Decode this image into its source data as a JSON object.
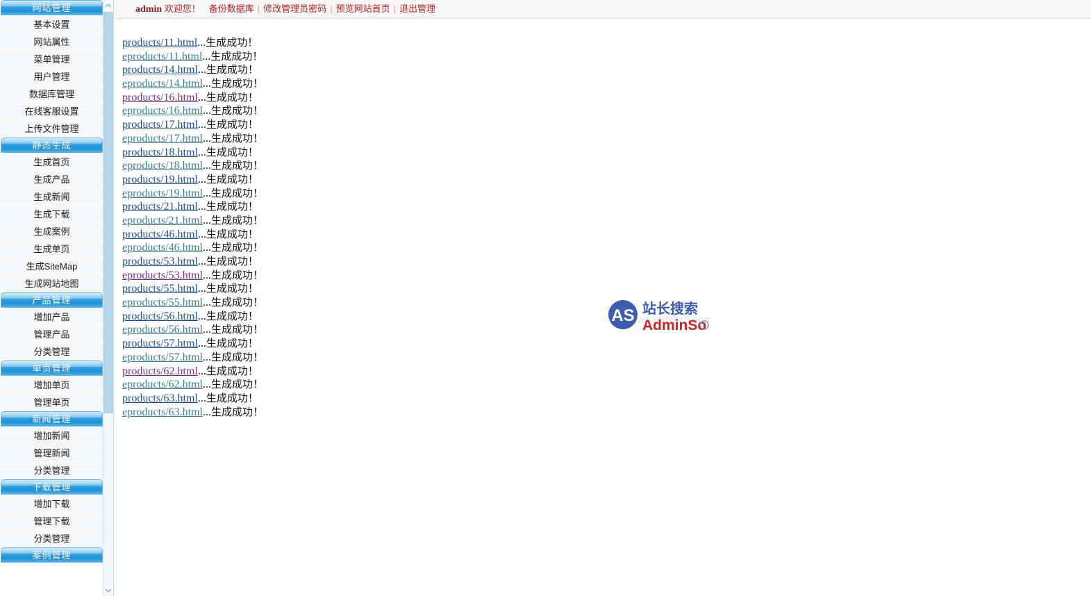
{
  "topbar": {
    "user": "admin",
    "welcome": "欢迎您！",
    "links": [
      {
        "label": "备份数据库"
      },
      {
        "label": "修改管理员密码"
      },
      {
        "label": "预览网站首页"
      },
      {
        "label": "退出管理"
      }
    ],
    "separator": "|"
  },
  "sidebar": {
    "scroll": {
      "up_icon": "chevron-up-icon",
      "down_icon": "chevron-down-icon"
    },
    "groups": [
      {
        "title": "网站管理",
        "items": [
          "基本设置",
          "网站属性",
          "菜单管理",
          "用户管理",
          "数据库管理",
          "在线客服设置",
          "上传文件管理"
        ]
      },
      {
        "title": "静态生成",
        "items": [
          "生成首页",
          "生成产品",
          "生成新闻",
          "生成下载",
          "生成案例",
          "生成单页",
          "生成SiteMap",
          "生成网站地图"
        ]
      },
      {
        "title": "产品管理",
        "items": [
          "增加产品",
          "管理产品",
          "分类管理"
        ]
      },
      {
        "title": "单页管理",
        "items": [
          "增加单页",
          "管理单页"
        ]
      },
      {
        "title": "新闻管理",
        "items": [
          "增加新闻",
          "管理新闻",
          "分类管理"
        ]
      },
      {
        "title": "下载管理",
        "items": [
          "增加下载",
          "管理下载",
          "分类管理"
        ]
      },
      {
        "title": "案例管理",
        "items": []
      }
    ]
  },
  "main": {
    "status_suffix": "生成成功！",
    "dots": "...",
    "rows": [
      {
        "file": "products/11.html",
        "state": "blue",
        "status": "生成成功！"
      },
      {
        "file": "eproducts/11.html",
        "state": "teal",
        "status": "生成成功！"
      },
      {
        "file": "products/14.html",
        "state": "blue",
        "status": "生成成功！"
      },
      {
        "file": "eproducts/14.html",
        "state": "teal",
        "status": "生成成功！"
      },
      {
        "file": "products/16.html",
        "state": "purple",
        "status": "生成成功！"
      },
      {
        "file": "eproducts/16.html",
        "state": "teal",
        "status": "生成成功！"
      },
      {
        "file": "products/17.html",
        "state": "blue",
        "status": "生成成功！"
      },
      {
        "file": "eproducts/17.html",
        "state": "teal",
        "status": "生成成功！"
      },
      {
        "file": "products/18.html",
        "state": "blue",
        "status": "生成成功！"
      },
      {
        "file": "eproducts/18.html",
        "state": "teal",
        "status": "生成成功！"
      },
      {
        "file": "products/19.html",
        "state": "blue",
        "status": "生成成功！"
      },
      {
        "file": "eproducts/19.html",
        "state": "teal",
        "status": "生成成功！"
      },
      {
        "file": "products/21.html",
        "state": "blue",
        "status": "生成成功！"
      },
      {
        "file": "eproducts/21.html",
        "state": "teal",
        "status": "生成成功！"
      },
      {
        "file": "products/46.html",
        "state": "blue",
        "status": "生成成功！"
      },
      {
        "file": "eproducts/46.html",
        "state": "teal",
        "status": "生成成功！"
      },
      {
        "file": "products/53.html",
        "state": "blue",
        "status": "生成成功！"
      },
      {
        "file": "eproducts/53.html",
        "state": "purple",
        "status": "生成成功！"
      },
      {
        "file": "products/55.html",
        "state": "blue",
        "status": "生成成功！"
      },
      {
        "file": "eproducts/55.html",
        "state": "teal",
        "status": "生成成功！"
      },
      {
        "file": "products/56.html",
        "state": "blue",
        "status": "生成成功！"
      },
      {
        "file": "eproducts/56.html",
        "state": "teal",
        "status": "生成成功！"
      },
      {
        "file": "products/57.html",
        "state": "blue",
        "status": "生成成功！"
      },
      {
        "file": "eproducts/57.html",
        "state": "teal",
        "status": "生成成功！"
      },
      {
        "file": "products/62.html",
        "state": "purple",
        "status": "生成成功！"
      },
      {
        "file": "eproducts/62.html",
        "state": "teal",
        "status": "生成成功！"
      },
      {
        "file": "products/63.html",
        "state": "blue",
        "status": "生成成功！"
      },
      {
        "file": "eproducts/63.html",
        "state": "teal",
        "status": "生成成功！"
      }
    ]
  },
  "watermark": {
    "mark": "AS",
    "cn_name": "站长搜索",
    "en_name": "AdminSo",
    "colors": {
      "blue": "#2f4fa8",
      "red": "#cc1111"
    }
  },
  "colors": {
    "nav_header_blue": "#2f9fe0",
    "link_blue": "#1a4f9c",
    "link_teal": "#3d7f94",
    "link_visited": "#7b2d8e",
    "topbar_red": "#b22222"
  }
}
